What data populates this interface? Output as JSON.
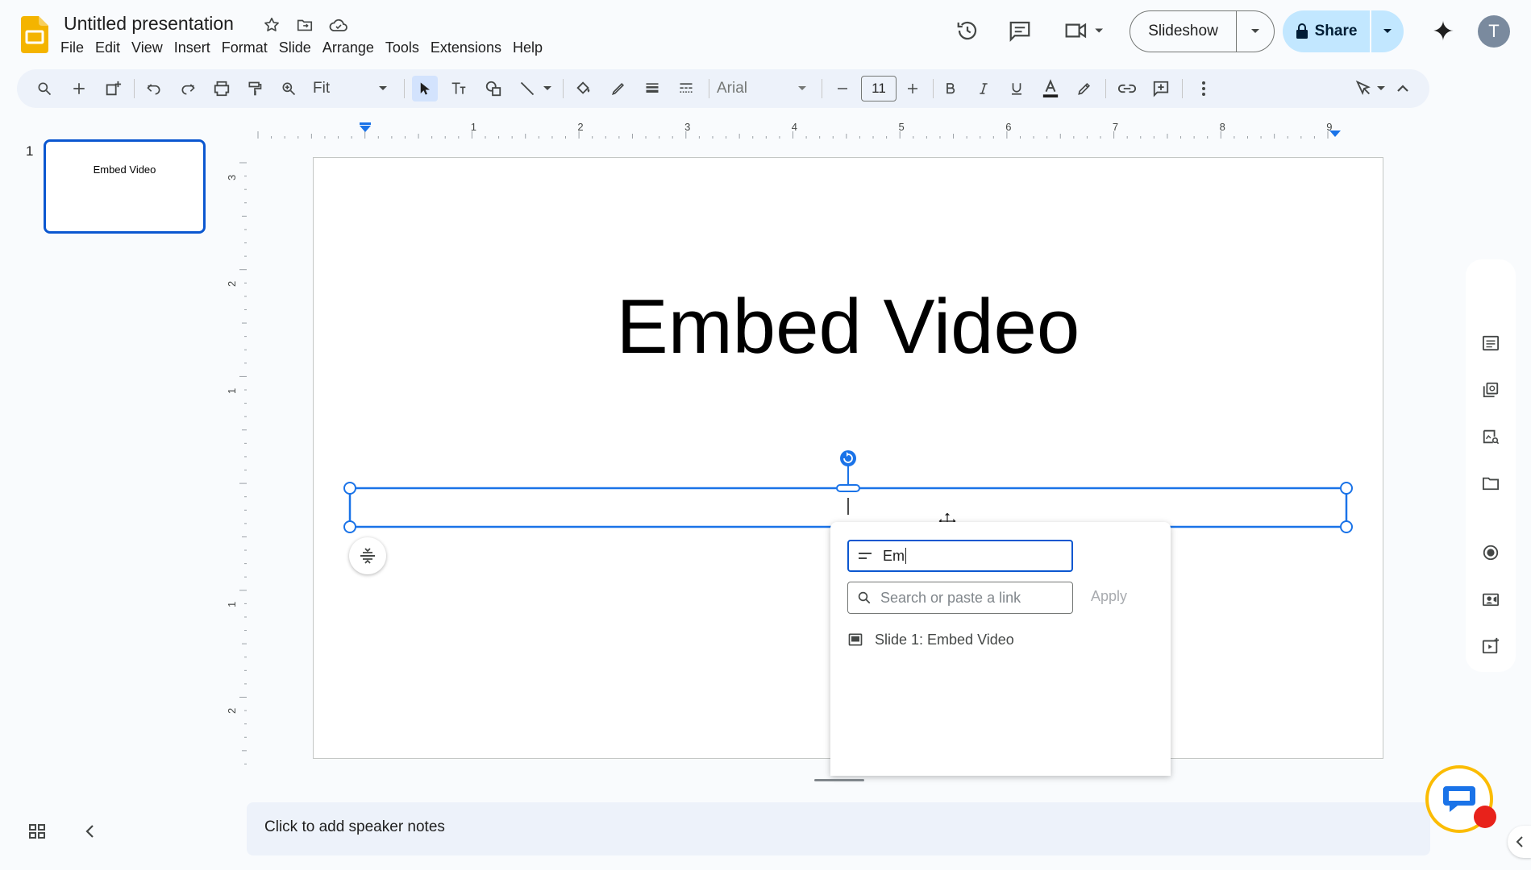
{
  "app": {
    "doc_title": "Untitled presentation",
    "menu": [
      "File",
      "Edit",
      "View",
      "Insert",
      "Format",
      "Slide",
      "Arrange",
      "Tools",
      "Extensions",
      "Help"
    ],
    "icons": {
      "title": [
        "star-icon",
        "move-to-folder-icon",
        "cloud-saved-icon"
      ],
      "header": [
        "version-history-icon",
        "comments-icon",
        "meet-video-icon"
      ]
    }
  },
  "header": {
    "slideshow_label": "Slideshow",
    "share_label": "Share",
    "avatar_initial": "T"
  },
  "toolbar": {
    "zoom_value": "Fit",
    "font_name": "Arial",
    "font_size": "11"
  },
  "filmstrip": {
    "slides": [
      {
        "number": "1",
        "title": "Embed Video"
      }
    ]
  },
  "rulers": {
    "top_labels": [
      "1",
      "2",
      "3",
      "4",
      "5",
      "6",
      "7",
      "8",
      "9"
    ],
    "left_labels": [
      "3",
      "2",
      "1",
      "1",
      "2"
    ]
  },
  "slide": {
    "title": "Embed Video"
  },
  "link_popup": {
    "text_value": "Em",
    "search_placeholder": "Search or paste a link",
    "apply_label": "Apply",
    "suggestions": [
      {
        "label": "Slide 1: Embed Video"
      }
    ]
  },
  "notes": {
    "placeholder": "Click to add speaker notes"
  },
  "colors": {
    "accent": "#0b57d0",
    "share_bg": "#c2e7ff",
    "logo": "#f4b400"
  }
}
